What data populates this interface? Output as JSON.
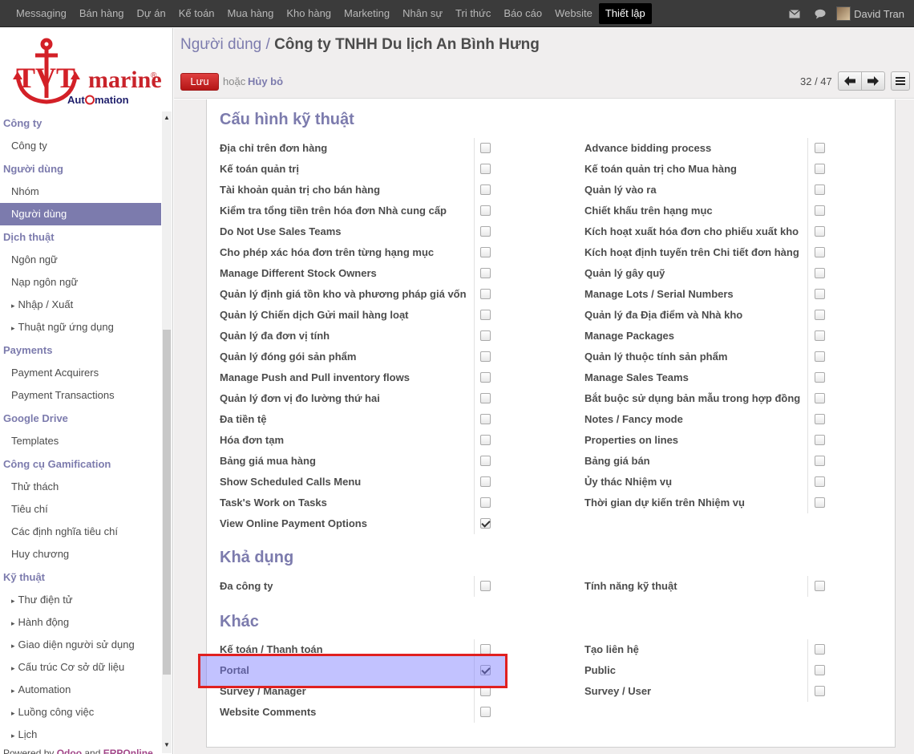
{
  "topbar": {
    "menu": [
      "Messaging",
      "Bán hàng",
      "Dự án",
      "Kế toán",
      "Mua hàng",
      "Kho hàng",
      "Marketing",
      "Nhân sự",
      "Tri thức",
      "Báo cáo",
      "Website",
      "Thiết lập"
    ],
    "active": "Thiết lập",
    "user": "David Tran",
    "icons": [
      "mail-icon",
      "chat-icon"
    ]
  },
  "logo": {
    "brand": "TVTmarine",
    "sub": "Automation"
  },
  "sidebar": {
    "sections": [
      {
        "title": "Công ty",
        "items": [
          {
            "label": "Công ty"
          }
        ]
      },
      {
        "title": "Người dùng",
        "items": [
          {
            "label": "Nhóm"
          },
          {
            "label": "Người dùng",
            "selected": true
          }
        ]
      },
      {
        "title": "Dịch thuật",
        "items": [
          {
            "label": "Ngôn ngữ"
          },
          {
            "label": "Nạp ngôn ngữ"
          },
          {
            "label": "Nhập / Xuất",
            "expandable": true
          },
          {
            "label": "Thuật ngữ ứng dụng",
            "expandable": true
          }
        ]
      },
      {
        "title": "Payments",
        "items": [
          {
            "label": "Payment Acquirers"
          },
          {
            "label": "Payment Transactions"
          }
        ]
      },
      {
        "title": "Google Drive",
        "items": [
          {
            "label": "Templates"
          }
        ]
      },
      {
        "title": "Công cụ Gamification",
        "items": [
          {
            "label": "Thử thách"
          },
          {
            "label": "Tiêu chí"
          },
          {
            "label": "Các định nghĩa tiêu chí"
          },
          {
            "label": "Huy chương"
          }
        ]
      },
      {
        "title": "Kỹ thuật",
        "items": [
          {
            "label": "Thư điện tử",
            "expandable": true
          },
          {
            "label": "Hành động",
            "expandable": true
          },
          {
            "label": "Giao diện người sử dụng",
            "expandable": true
          },
          {
            "label": "Cấu trúc Cơ sở dữ liệu",
            "expandable": true
          },
          {
            "label": "Automation",
            "expandable": true
          },
          {
            "label": "Luồng công việc",
            "expandable": true
          },
          {
            "label": "Lịch",
            "expandable": true
          }
        ]
      }
    ],
    "powered_prefix": "Powered by ",
    "powered_odoo": "Odoo",
    "powered_and": " and ",
    "powered_erp": "ERPOnline"
  },
  "header": {
    "breadcrumb_parent": "Người dùng",
    "breadcrumb_sep": " / ",
    "breadcrumb_current": "Công ty TNHH Du lịch An Bình Hưng",
    "save_label": "Lưu",
    "or_label": "hoặc",
    "discard_label": "Hủy bỏ",
    "pager": "32 / 47"
  },
  "form": {
    "sections": [
      {
        "title": "Cấu hình kỹ thuật",
        "rows": [
          [
            {
              "label": "Địa chỉ trên đơn hàng",
              "checked": false
            },
            {
              "label": "Advance bidding process",
              "checked": false
            }
          ],
          [
            {
              "label": "Kế toán quản trị",
              "checked": false
            },
            {
              "label": "Kế toán quản trị cho Mua hàng",
              "checked": false
            }
          ],
          [
            {
              "label": "Tài khoản quản trị cho bán hàng",
              "checked": false
            },
            {
              "label": "Quản lý vào ra",
              "checked": false
            }
          ],
          [
            {
              "label": "Kiểm tra tổng tiền trên hóa đơn Nhà cung cấp",
              "checked": false
            },
            {
              "label": "Chiết khấu trên hạng mục",
              "checked": false
            }
          ],
          [
            {
              "label": "Do Not Use Sales Teams",
              "checked": false
            },
            {
              "label": "Kích hoạt xuất hóa đơn cho phiếu xuất kho",
              "checked": false
            }
          ],
          [
            {
              "label": "Cho phép xác hóa đơn trên từng hạng mục",
              "checked": false
            },
            {
              "label": "Kích hoạt định tuyến trên Chi tiết đơn hàng",
              "checked": false
            }
          ],
          [
            {
              "label": "Manage Different Stock Owners",
              "checked": false
            },
            {
              "label": "Quản lý gây quỹ",
              "checked": false
            }
          ],
          [
            {
              "label": "Quản lý định giá tồn kho và phương pháp giá vốn",
              "checked": false
            },
            {
              "label": "Manage Lots / Serial Numbers",
              "checked": false
            }
          ],
          [
            {
              "label": "Quản lý Chiến dịch Gửi mail hàng loạt",
              "checked": false
            },
            {
              "label": "Quản lý đa Địa điểm và Nhà kho",
              "checked": false
            }
          ],
          [
            {
              "label": "Quản lý đa đơn vị tính",
              "checked": false
            },
            {
              "label": "Manage Packages",
              "checked": false
            }
          ],
          [
            {
              "label": "Quản lý đóng gói sản phẩm",
              "checked": false
            },
            {
              "label": "Quản lý thuộc tính sản phẩm",
              "checked": false
            }
          ],
          [
            {
              "label": "Manage Push and Pull inventory flows",
              "checked": false
            },
            {
              "label": "Manage Sales Teams",
              "checked": false
            }
          ],
          [
            {
              "label": "Quản lý đơn vị đo lường thứ hai",
              "checked": false
            },
            {
              "label": "Bắt buộc sử dụng bản mẫu trong hợp đồng",
              "checked": false
            }
          ],
          [
            {
              "label": "Đa tiền tệ",
              "checked": false
            },
            {
              "label": "Notes / Fancy mode",
              "checked": false
            }
          ],
          [
            {
              "label": "Hóa đơn tạm",
              "checked": false
            },
            {
              "label": "Properties on lines",
              "checked": false
            }
          ],
          [
            {
              "label": "Bảng giá mua hàng",
              "checked": false
            },
            {
              "label": "Bảng giá bán",
              "checked": false
            }
          ],
          [
            {
              "label": "Show Scheduled Calls Menu",
              "checked": false
            },
            {
              "label": "Ủy thác Nhiệm vụ",
              "checked": false
            }
          ],
          [
            {
              "label": "Task's Work on Tasks",
              "checked": false
            },
            {
              "label": "Thời gian dự kiến trên Nhiệm vụ",
              "checked": false
            }
          ],
          [
            {
              "label": "View Online Payment Options",
              "checked": true
            }
          ]
        ]
      },
      {
        "title": "Khả dụng",
        "rows": [
          [
            {
              "label": "Đa công ty",
              "checked": false
            },
            {
              "label": "Tính năng kỹ thuật",
              "checked": false
            }
          ]
        ]
      },
      {
        "title": "Khác",
        "rows": [
          [
            {
              "label": "Kế toán / Thanh toán",
              "checked": false
            },
            {
              "label": "Tạo liên hệ",
              "checked": false
            }
          ],
          [
            {
              "label": "Portal",
              "checked": true,
              "highlighted": true
            },
            {
              "label": "Public",
              "checked": false
            }
          ],
          [
            {
              "label": "Survey / Manager",
              "checked": false
            },
            {
              "label": "Survey / User",
              "checked": false
            }
          ],
          [
            {
              "label": "Website Comments",
              "checked": false
            }
          ]
        ]
      }
    ]
  },
  "colors": {
    "accent": "#7c7bad",
    "save": "#c52626",
    "highlight_border": "#e02020",
    "highlight_fill": "#9c9cff"
  }
}
